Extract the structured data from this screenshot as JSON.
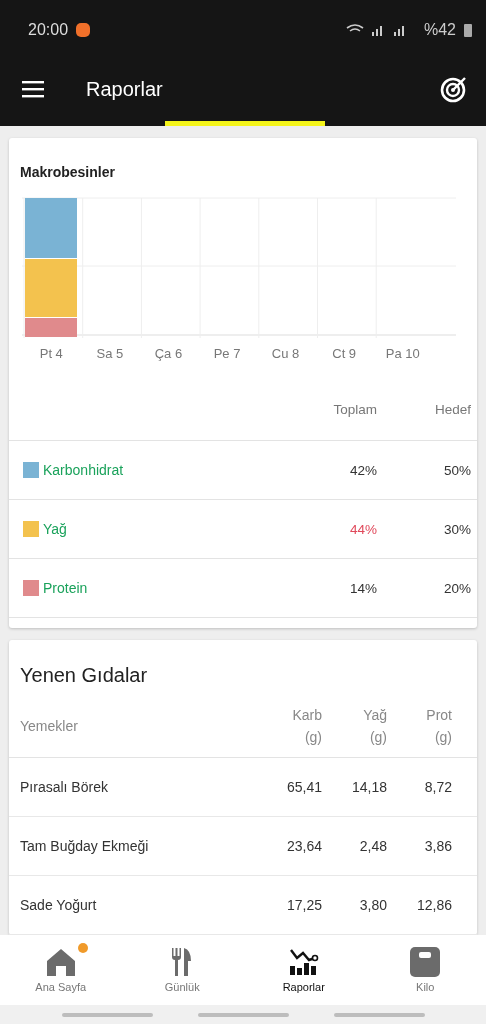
{
  "status_bar": {
    "time": "20:00",
    "battery": "%42"
  },
  "app_bar": {
    "title": "Raporlar"
  },
  "macros_card": {
    "title": "Makrobesinler",
    "day_labels": [
      "Pt 4",
      "Sa 5",
      "Ça 6",
      "Pe 7",
      "Cu 8",
      "Ct 9",
      "Pa 10"
    ],
    "columns": [
      "Toplam",
      "Hedef"
    ],
    "rows": [
      {
        "name": "Karbonhidrat",
        "color": "#7ab3d4",
        "total": "42%",
        "target": "50%",
        "over": false
      },
      {
        "name": "Yağ",
        "color": "#f3c24e",
        "total": "44%",
        "target": "30%",
        "over": true
      },
      {
        "name": "Protein",
        "color": "#e08a8c",
        "total": "14%",
        "target": "20%",
        "over": false
      }
    ]
  },
  "foods_card": {
    "title": "Yenen Gıdalar",
    "columns": [
      {
        "label": "Yemekler"
      },
      {
        "label": "Karb",
        "unit": "(g)"
      },
      {
        "label": "Yağ",
        "unit": "(g)"
      },
      {
        "label": "Prot",
        "unit": "(g)"
      }
    ],
    "rows": [
      [
        "Pırasalı Börek",
        "65,41",
        "14,18",
        "8,72"
      ],
      [
        "Tam Buğday Ekmeği",
        "23,64",
        "2,48",
        "3,86"
      ],
      [
        "Sade Yoğurt",
        "17,25",
        "3,80",
        "12,86"
      ]
    ]
  },
  "bottom_nav": [
    {
      "kind": "home",
      "label": "Ana Sayfa",
      "selected": false,
      "notification": true
    },
    {
      "kind": "diary",
      "label": "Günlük",
      "selected": false,
      "notification": false
    },
    {
      "kind": "reports",
      "label": "Raporlar",
      "selected": true,
      "notification": false
    },
    {
      "kind": "weight",
      "label": "Kilo",
      "selected": false,
      "notification": false
    }
  ]
}
